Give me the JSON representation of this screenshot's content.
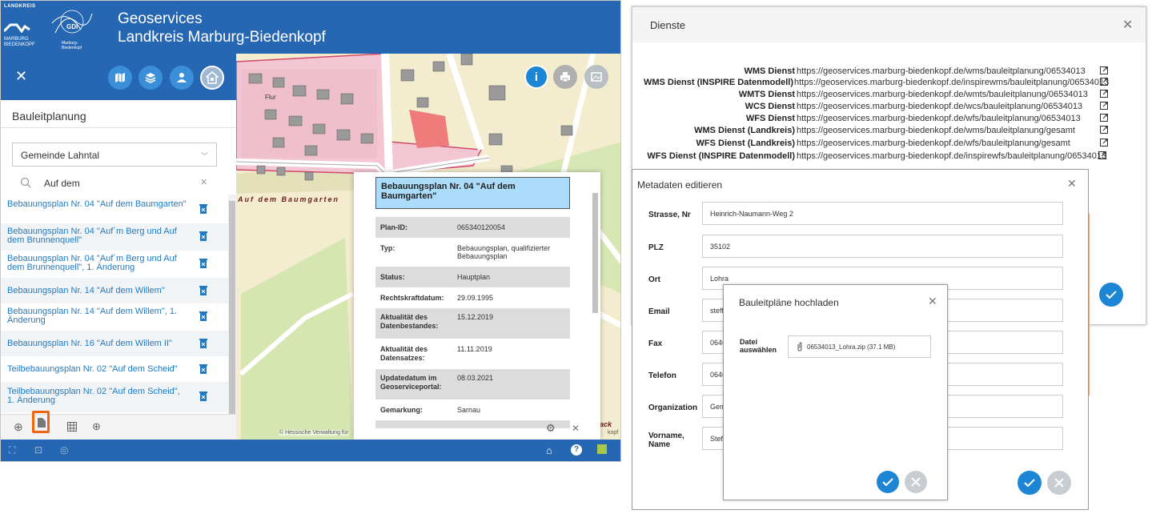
{
  "header": {
    "logo_landkreis_top": "LANDKREIS",
    "logo_landkreis_bottom1": "MARBURG",
    "logo_landkreis_bottom2": "BIEDENKOPF",
    "logo_gdi": "GDI",
    "logo_gdi_sub": "Marburg-Biedenkopf",
    "title_line1": "Geoservices",
    "title_line2": "Landkreis Marburg-Biedenkopf"
  },
  "map": {
    "labels": [
      "Auf dem Baumgarten",
      "Flur"
    ],
    "attribution": "© Hessische Verwaltung für",
    "attribution_right": "kopf",
    "frag_right": "ack"
  },
  "sidebar": {
    "title": "Bauleitplanung",
    "gemeinde_select": "Gemeinde Lahntal",
    "search_value": "Auf dem",
    "plans": [
      "Bebauungsplan Nr. 04 \"Auf dem Baumgarten\"",
      "Bebauungsplan Nr. 04 \"Auf´m Berg und Auf dem Brunnenquell\"",
      "Bebauungsplan Nr. 04 \"Auf´m Berg und Auf dem Brunnenquell\", 1. Änderung",
      "Bebauungsplan Nr. 14 \"Auf dem Willem\"",
      "Bebauungsplan Nr. 14 \"Auf dem Willem\", 1. Änderung",
      "Bebauungsplan Nr. 16 \"Auf dem Willem II\"",
      "Teilbebauungsplan Nr. 02 \"Auf dem Scheid\"",
      "Teilbebauungsplan Nr. 02 \"Auf dem Scheid\", 1. Änderung"
    ]
  },
  "info": {
    "title": "Bebauungsplan Nr. 04 \"Auf dem Baumgarten\"",
    "rows": [
      {
        "k": "Plan-ID:",
        "v": "065340120054"
      },
      {
        "k": "Typ:",
        "v": "Bebauungsplan, qualifizierter Bebauungsplan"
      },
      {
        "k": "Status:",
        "v": "Hauptplan"
      },
      {
        "k": "Rechtskraftdatum:",
        "v": "29.09.1995"
      },
      {
        "k": "Aktualität des Datenbestandes:",
        "v": "15.12.2019"
      },
      {
        "k": "Aktualität des Datensatzes:",
        "v": "11.11.2019"
      },
      {
        "k": "Updatedatum im Geoserviceportal:",
        "v": "08.03.2021"
      },
      {
        "k": "Gemarkung:",
        "v": "Sarnau"
      }
    ]
  },
  "dienste": {
    "title": "Dienste",
    "rows": [
      {
        "name": "WMS Dienst",
        "url": "https://geoservices.marburg-biedenkopf.de/wms/bauleitplanung/06534013"
      },
      {
        "name": "WMS Dienst (INSPIRE Datenmodell)",
        "url": "https://geoservices.marburg-biedenkopf.de/inspirewms/bauleitplanung/06534013"
      },
      {
        "name": "WMTS Dienst",
        "url": "https://geoservices.marburg-biedenkopf.de/wmts/bauleitplanung/06534013"
      },
      {
        "name": "WCS Dienst",
        "url": "https://geoservices.marburg-biedenkopf.de/wcs/bauleitplanung/06534013"
      },
      {
        "name": "WFS Dienst",
        "url": "https://geoservices.marburg-biedenkopf.de/wfs/bauleitplanung/06534013"
      },
      {
        "name": "WMS Dienst (Landkreis)",
        "url": "https://geoservices.marburg-biedenkopf.de/wms/bauleitplanung/gesamt"
      },
      {
        "name": "WFS Dienst (Landkreis)",
        "url": "https://geoservices.marburg-biedenkopf.de/wfs/bauleitplanung/gesamt"
      },
      {
        "name": "WFS Dienst (INSPIRE Datenmodell)",
        "url": "https://geoservices.marburg-biedenkopf.de/inspirewfs/bauleitplanung/06534013"
      }
    ]
  },
  "metadaten": {
    "title": "Metadaten editieren",
    "fields": [
      {
        "label": "Strasse, Nr",
        "value": "Heinrich-Naumann-Weg 2"
      },
      {
        "label": "PLZ",
        "value": "35102"
      },
      {
        "label": "Ort",
        "value": "Lohra"
      },
      {
        "label": "Email",
        "value": "steff"
      },
      {
        "label": "Fax",
        "value": "0646"
      },
      {
        "label": "Telefon",
        "value": "0646"
      },
      {
        "label": "Organization",
        "value": "Gem"
      },
      {
        "label": "Vorname, Name",
        "value": "Steff"
      }
    ]
  },
  "upload": {
    "title": "Bauleitpläne hochladen",
    "label": "Datei auswählen",
    "file": "06534013_Lohra.zip (37.1 MB)"
  },
  "colors": {
    "primary": "#2667b3",
    "accent_button": "#3a8fd8",
    "link": "#1f7ac3",
    "ok": "#1d86d4",
    "highlight": "#ee6611"
  }
}
